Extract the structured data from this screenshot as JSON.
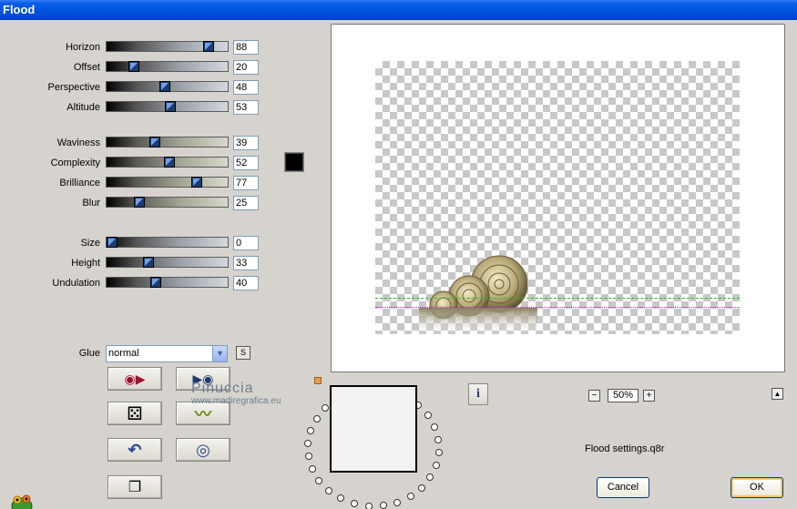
{
  "window": {
    "title": "Flood"
  },
  "sliders_group1": [
    {
      "label": "Horizon",
      "value": "88",
      "pos": 88
    },
    {
      "label": "Offset",
      "value": "20",
      "pos": 20
    },
    {
      "label": "Perspective",
      "value": "48",
      "pos": 48
    },
    {
      "label": "Altitude",
      "value": "53",
      "pos": 53
    }
  ],
  "sliders_group2": [
    {
      "label": "Waviness",
      "value": "39",
      "pos": 39
    },
    {
      "label": "Complexity",
      "value": "52",
      "pos": 52
    },
    {
      "label": "Brilliance",
      "value": "77",
      "pos": 77
    },
    {
      "label": "Blur",
      "value": "25",
      "pos": 25
    }
  ],
  "sliders_group3": [
    {
      "label": "Size",
      "value": "0",
      "pos": 0
    },
    {
      "label": "Height",
      "value": "33",
      "pos": 33
    },
    {
      "label": "Undulation",
      "value": "40",
      "pos": 40
    }
  ],
  "color": {
    "swatch": "#000000"
  },
  "glue": {
    "label": "Glue",
    "value": "normal",
    "small_button": "S"
  },
  "buttons": {
    "reset_icon": "◉▶",
    "play_icon": "▶◉",
    "random_icon": "⚄",
    "wave_icon": "〰",
    "undo_icon": "↶",
    "stop_icon": "◎",
    "copy_icon": "❐"
  },
  "watermark": {
    "name": "Pinuccia",
    "site": "www.madiregrafica.eu"
  },
  "info_button": "i",
  "zoom": {
    "minus": "−",
    "value": "50%",
    "plus": "+"
  },
  "preset": {
    "filename": "Flood settings.q8r"
  },
  "dialog": {
    "cancel": "Cancel",
    "ok": "OK"
  },
  "up_button": "▲"
}
